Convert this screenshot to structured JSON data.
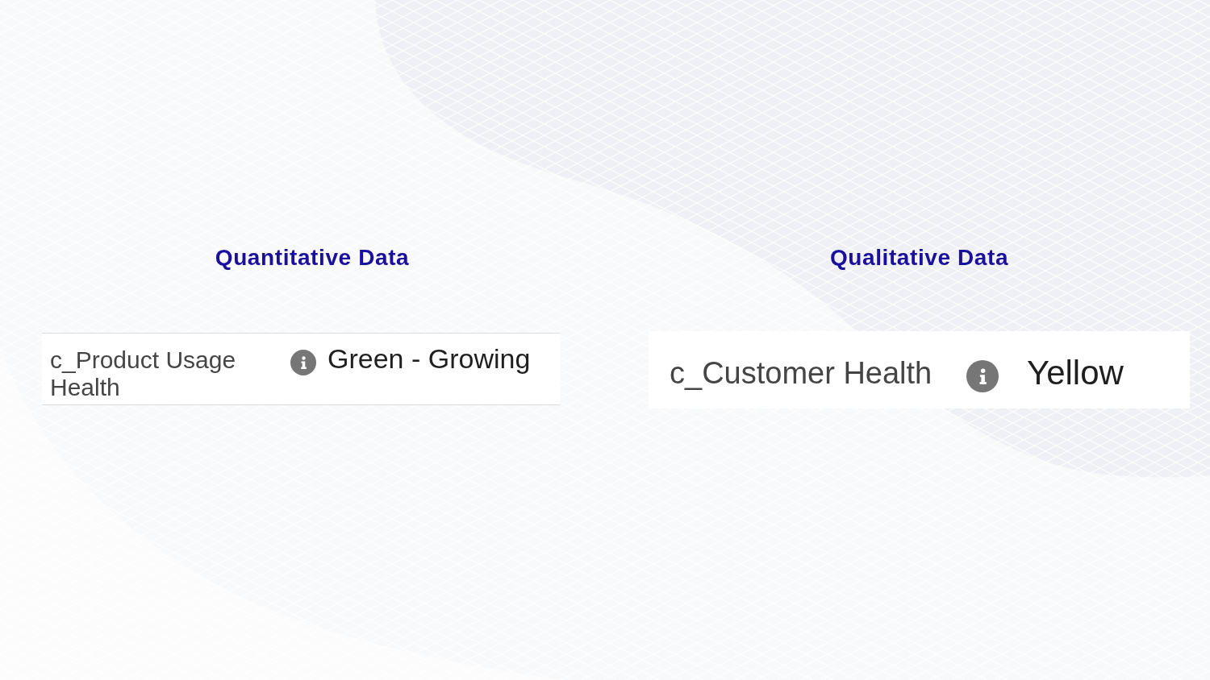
{
  "sections": [
    {
      "heading": "Quantitative Data",
      "field": {
        "label": "c_Product Usage Health",
        "value": "Green - Growing"
      }
    },
    {
      "heading": "Qualitative Data",
      "field": {
        "label": "c_Customer Health",
        "value": "Yellow"
      }
    }
  ]
}
